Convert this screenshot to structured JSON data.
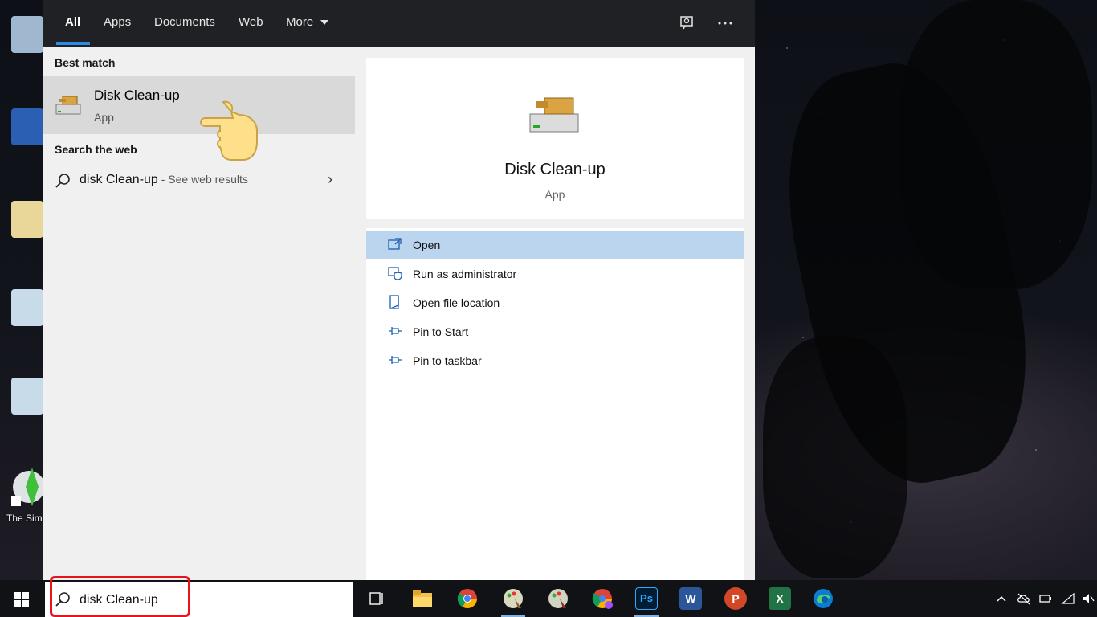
{
  "tabs": [
    {
      "label": "All"
    },
    {
      "label": "Apps"
    },
    {
      "label": "Documents"
    },
    {
      "label": "Web"
    },
    {
      "label": "More"
    }
  ],
  "topbar_icons": [
    "feedback-icon",
    "more-options-icon"
  ],
  "sections": {
    "best_match": "Best match",
    "search_web": "Search the web"
  },
  "best_match": {
    "title": "Disk Clean-up",
    "type": "App"
  },
  "web_result": {
    "query": "disk Clean-up",
    "hint": " - See web results"
  },
  "detail": {
    "title": "Disk Clean-up",
    "type": "App"
  },
  "actions": [
    {
      "label": "Open",
      "icon": "open-icon",
      "selected": true
    },
    {
      "label": "Run as administrator",
      "icon": "shield-admin-icon"
    },
    {
      "label": "Open file location",
      "icon": "folder-location-icon"
    },
    {
      "label": "Pin to Start",
      "icon": "pin-icon"
    },
    {
      "label": "Pin to taskbar",
      "icon": "pin-icon"
    }
  ],
  "searchbox": {
    "value": "disk Clean-up"
  },
  "desktop": {
    "visible_label": "The Sim"
  },
  "taskbar_apps": [
    "task-view-icon",
    "file-explorer-icon",
    "chrome-icon",
    "paint-app-icon",
    "paint-app-2-icon",
    "chrome-profile-icon",
    "photoshop-icon",
    "word-icon",
    "powerpoint-icon",
    "excel-icon",
    "edge-icon"
  ],
  "taskbar_app_labels": {
    "photoshop": "Ps",
    "word": "W",
    "powerpoint": "P",
    "excel": "X"
  },
  "colors": {
    "accent": "#2e8be6",
    "selection": "#bcd5ee",
    "highlight_box": "#e8141b"
  }
}
